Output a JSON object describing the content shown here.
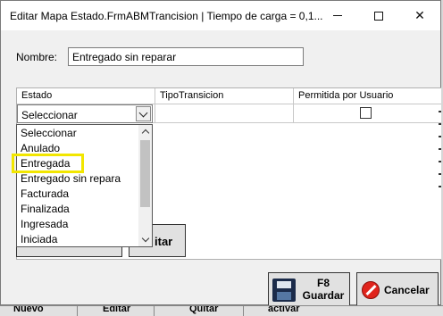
{
  "window": {
    "title": "Editar Mapa Estado.FrmABMTrancision | Tiempo de carga = 0,1...",
    "minimize_icon": "minimize-icon",
    "maximize_icon": "maximize-icon",
    "close_icon": "close-icon",
    "close_glyph": "✕"
  },
  "form": {
    "nombre_label": "Nombre:",
    "nombre_value": "Entregado sin reparar"
  },
  "grid": {
    "columns": [
      "Estado",
      "TipoTransicion",
      "Permitida por Usuario"
    ],
    "row": {
      "estado": "Seleccionar",
      "tipo": "",
      "permitida": false
    }
  },
  "dropdown": {
    "items": [
      "Seleccionar",
      "Anulado",
      "Entregada",
      "Entregado sin repara",
      "Facturada",
      "Finalizada",
      "Ingresada",
      "Iniciada"
    ],
    "highlighted_item": "Entregada",
    "highlight_color": "#f2e600"
  },
  "hidden_buttons": {
    "edit_label_partial": "itar"
  },
  "buttons": {
    "guardar_key": "F8",
    "guardar_label": "Guardar",
    "cancelar_label": "Cancelar",
    "guardar_icon": "floppy-disk-icon",
    "cancelar_icon": "stop-icon"
  },
  "background_bar": {
    "labels": [
      "Nuevo",
      "Editar",
      "Quitar",
      "activar"
    ]
  }
}
